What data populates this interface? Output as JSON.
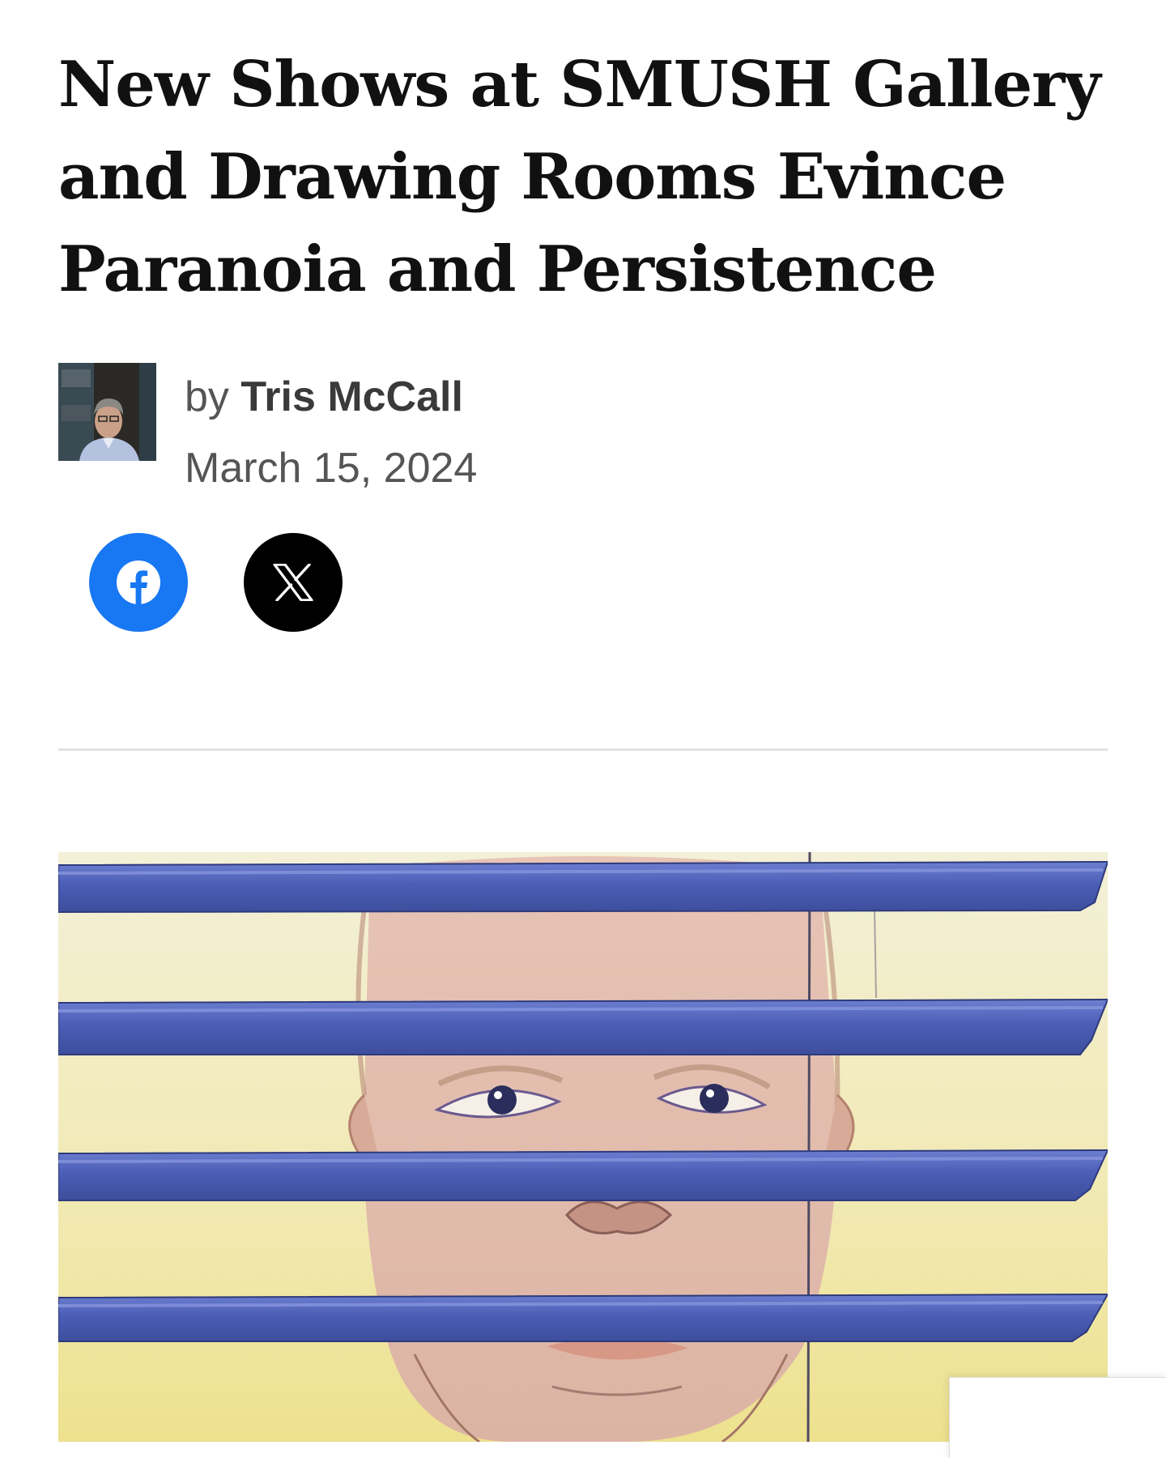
{
  "article": {
    "title": "New Shows at SMUSH Gallery and Drawing Rooms Evince Paranoia and Persistence",
    "byline": {
      "prefix": "by",
      "author": "Tris McCall",
      "date": "March 15, 2024"
    },
    "share": [
      {
        "network": "facebook",
        "icon": "facebook-icon",
        "color": "#1877f2"
      },
      {
        "network": "x",
        "icon": "x-icon",
        "color": "#000000"
      }
    ],
    "hero_image": {
      "subject": "pencil drawing of a face behind blue window blinds"
    }
  },
  "colors": {
    "text": "#111111",
    "meta": "#555555",
    "divider": "#e2e2e2",
    "blind_blue": "#4a5bb0",
    "background_yellow": "#f2ecc4"
  }
}
